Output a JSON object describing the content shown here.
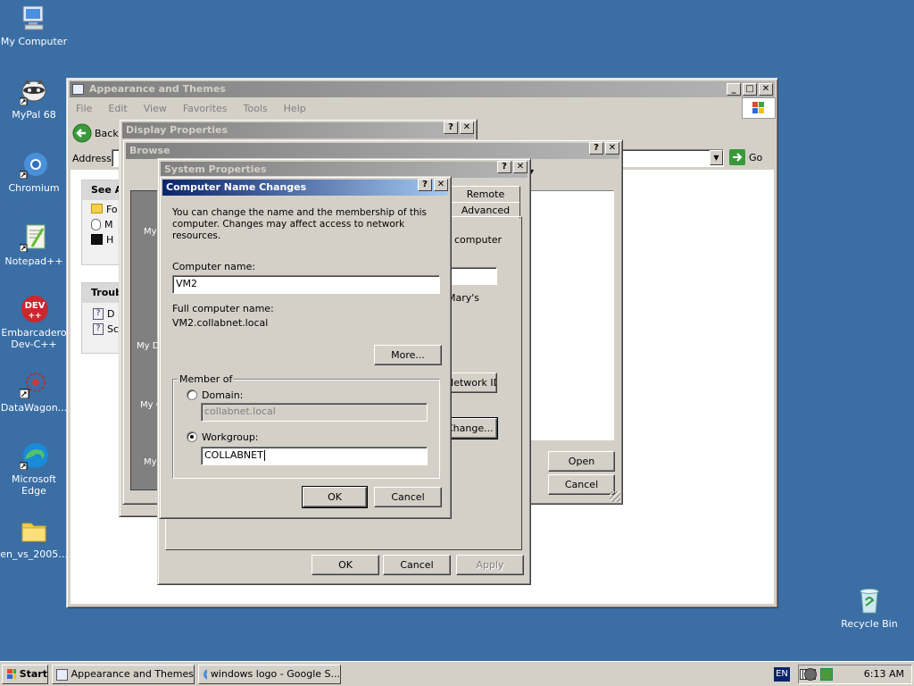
{
  "desktop": {
    "icons": [
      {
        "label": "My Computer",
        "icon": "computer-icon"
      },
      {
        "label": "MyPal 68",
        "icon": "mypal-icon"
      },
      {
        "label": "Chromium",
        "icon": "chromium-icon"
      },
      {
        "label": "Notepad++",
        "icon": "notepadpp-icon"
      },
      {
        "label": "Embarcadero Dev-C++",
        "icon": "devcpp-icon"
      },
      {
        "label": "DataWagon...",
        "icon": "datawagon-icon"
      },
      {
        "label": "Microsoft Edge",
        "icon": "edge-icon"
      },
      {
        "label": "en_vs_2005...",
        "icon": "folder-icon"
      },
      {
        "label": "Recycle Bin",
        "icon": "recycle-bin-icon"
      }
    ],
    "devcpp_badge": "DEV"
  },
  "explorer": {
    "title": "Appearance and Themes",
    "menu": [
      "File",
      "Edit",
      "View",
      "Favorites",
      "Tools",
      "Help"
    ],
    "back_label": "Back",
    "address_label": "Address",
    "go_label": "Go",
    "see_also": "See A",
    "see_also_items": [
      "Fo",
      "M",
      "H"
    ],
    "trouble": "Troub",
    "trouble_items": [
      "D",
      "Sc"
    ]
  },
  "display_props": {
    "title": "Display Properties"
  },
  "browse": {
    "title": "Browse",
    "places": [
      "My Doc",
      "My D",
      "My C",
      "My N"
    ],
    "open_label": "Open",
    "cancel_label": "Cancel"
  },
  "sysprops": {
    "title": "System Properties",
    "tabs": [
      "Remote",
      "Advanced"
    ],
    "frag_computer": "computer",
    "frag_marys": "Mary's",
    "network_id_label": "Network ID",
    "change_label": "Change...",
    "ok_label": "OK",
    "cancel_label": "Cancel",
    "apply_label": "Apply"
  },
  "cnc": {
    "title": "Computer Name Changes",
    "description": "You can change the name and the membership of this computer. Changes may affect access to network resources.",
    "computer_name_label": "Computer name:",
    "computer_name_value": "VM2",
    "full_name_label": "Full computer name:",
    "full_name_value": "VM2.collabnet.local",
    "more_label": "More...",
    "member_of_label": "Member of",
    "domain_label": "Domain:",
    "domain_value": "collabnet.local",
    "workgroup_label": "Workgroup:",
    "workgroup_value": "COLLABNET",
    "ok_label": "OK",
    "cancel_label": "Cancel"
  },
  "taskbar": {
    "start_label": "Start",
    "buttons": [
      "Appearance and Themes",
      "windows logo - Google S..."
    ],
    "lang": "EN",
    "clock": "6:13 AM"
  },
  "colors": {
    "desktop": "#3a6ea5",
    "titlebar_active": "#0a246a",
    "face": "#d4d0c8"
  }
}
